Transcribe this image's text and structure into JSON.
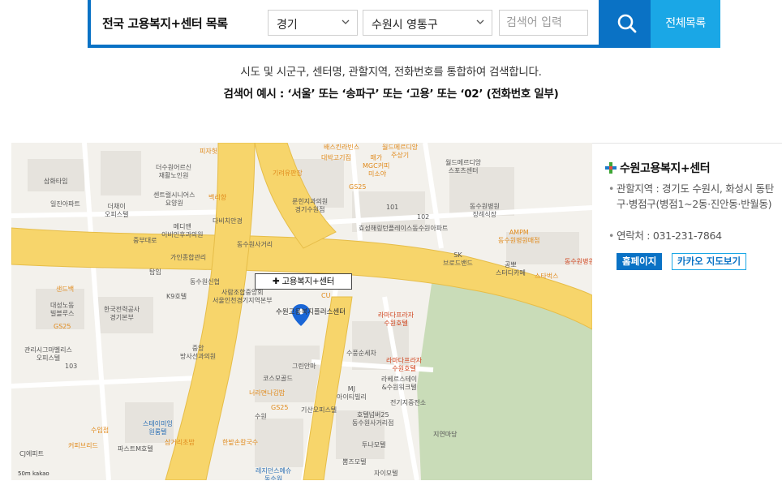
{
  "search": {
    "title": "전국 고용복지+센터 목록",
    "region_select": "경기",
    "city_select": "수원시 영통구",
    "input_placeholder": "검색어 입력",
    "all_list_button": "전체목록"
  },
  "description": {
    "line1": "시도 및 시군구, 센터명, 관할지역, 전화번호를 통합하여 검색합니다.",
    "line2": "검색어 예시 : ‘서울’ 또는 ‘송파구’ 또는 ‘고용’ 또는 ‘02’ (전화번호 일부)"
  },
  "map": {
    "info_window": "고용복지+센터",
    "marker_label": "수원고용복지플러스센터",
    "scale": "50m",
    "provider": "kakao",
    "labels": [
      {
        "t": "피자헛",
        "c": "orange"
      },
      {
        "t": "배스킨라빈스",
        "c": "orange"
      },
      {
        "t": "월드메르디앙\n주상기",
        "c": "orange"
      },
      {
        "t": "대박고기집",
        "c": "orange"
      },
      {
        "t": "매가\nMGC커피",
        "c": "orange"
      },
      {
        "t": "미소야",
        "c": "orange"
      },
      {
        "t": "월드메르디앙\n스포츠센터",
        "c": ""
      },
      {
        "t": "삼화타임",
        "c": ""
      },
      {
        "t": "일진아파트",
        "c": ""
      },
      {
        "t": "더수원어르신\n재활노인원",
        "c": ""
      },
      {
        "t": "더채이\n오피스텔",
        "c": ""
      },
      {
        "t": "센트럴시니어스\n요양원",
        "c": ""
      },
      {
        "t": "백리향",
        "c": "orange"
      },
      {
        "t": "기려유판장",
        "c": "orange"
      },
      {
        "t": "GS25",
        "c": "orange"
      },
      {
        "t": "룬힌지과의원\n경기수원점",
        "c": ""
      },
      {
        "t": "동수원병원\n장례식장",
        "c": ""
      },
      {
        "t": "메디앤\n이비인후과의원",
        "c": ""
      },
      {
        "t": "다비치안경",
        "c": ""
      },
      {
        "t": "효성해링턴플레이스동수원아파트",
        "c": ""
      },
      {
        "t": "AMPM\n동수원병원매점",
        "c": "orange"
      },
      {
        "t": "동수원병원",
        "c": "red"
      },
      {
        "t": "중부대로",
        "c": ""
      },
      {
        "t": "동수원사거리",
        "c": ""
      },
      {
        "t": "SK\n브로드밴드",
        "c": ""
      },
      {
        "t": "공뽀\n스터디카페",
        "c": ""
      },
      {
        "t": "스타벅스",
        "c": "orange"
      },
      {
        "t": "가인종합관리",
        "c": ""
      },
      {
        "t": "탑임",
        "c": ""
      },
      {
        "t": "동수원신협",
        "c": ""
      },
      {
        "t": "사람조합중앙회\n서울인천경기지역본부",
        "c": ""
      },
      {
        "t": "K9호텔",
        "c": ""
      },
      {
        "t": "샌드백",
        "c": "orange"
      },
      {
        "t": "대성노동\n빌블루스",
        "c": ""
      },
      {
        "t": "한국전력공사\n경기본부",
        "c": ""
      },
      {
        "t": "CU",
        "c": "orange"
      },
      {
        "t": "라마다프라자\n수원호텔",
        "c": "red"
      },
      {
        "t": "GS25",
        "c": "orange"
      },
      {
        "t": "관리시그마벨리스\n오피스텔",
        "c": ""
      },
      {
        "t": "중앙\n방사선과의원",
        "c": ""
      },
      {
        "t": "수풍순세차",
        "c": ""
      },
      {
        "t": "라마다프라자\n수원호텔",
        "c": "red"
      },
      {
        "t": "그린안마",
        "c": ""
      },
      {
        "t": "코스모골드",
        "c": ""
      },
      {
        "t": "라베르스테이\n&수원워크텔",
        "c": ""
      },
      {
        "t": "MJ\n아이티빌리",
        "c": ""
      },
      {
        "t": "너라면나김밥",
        "c": "orange"
      },
      {
        "t": "전기지중전소",
        "c": ""
      },
      {
        "t": "GS25",
        "c": "orange"
      },
      {
        "t": "기산오피스텔",
        "c": ""
      },
      {
        "t": "호텔넘버25\n동수원사거리점",
        "c": ""
      },
      {
        "t": "수원",
        "c": ""
      },
      {
        "t": "스테이미잉\n원룸텔",
        "c": "blue"
      },
      {
        "t": "수입점",
        "c": "orange"
      },
      {
        "t": "커피브리드",
        "c": "orange"
      },
      {
        "t": "파스트M호텔",
        "c": ""
      },
      {
        "t": "삼거리초밥",
        "c": "orange"
      },
      {
        "t": "한밭손칼국수",
        "c": "orange"
      },
      {
        "t": "지연마당",
        "c": ""
      },
      {
        "t": "투나모텔",
        "c": ""
      },
      {
        "t": "뽐즈모텔",
        "c": ""
      },
      {
        "t": "자이모텔",
        "c": ""
      },
      {
        "t": "레지던스예슈\n동수원",
        "c": "blue"
      },
      {
        "t": "CJ에피트",
        "c": ""
      },
      {
        "t": "101",
        "c": ""
      },
      {
        "t": "102",
        "c": ""
      },
      {
        "t": "103",
        "c": ""
      }
    ]
  },
  "center": {
    "name": "수원고용복지+센터",
    "area": "관할지역 : 경기도 수원시, 화성시 동탄구·병점구(병점1~2동·진안동·반월동)",
    "phone": "연락처 : 031-231-7864",
    "homepage_button": "홈페이지",
    "kakao_button": "카카오 지도보기"
  },
  "colors": {
    "primary_blue": "#0a72c5",
    "light_blue": "#1aa7e6",
    "road_yellow": "#f7d56b",
    "park_green": "#c9dcb8"
  }
}
